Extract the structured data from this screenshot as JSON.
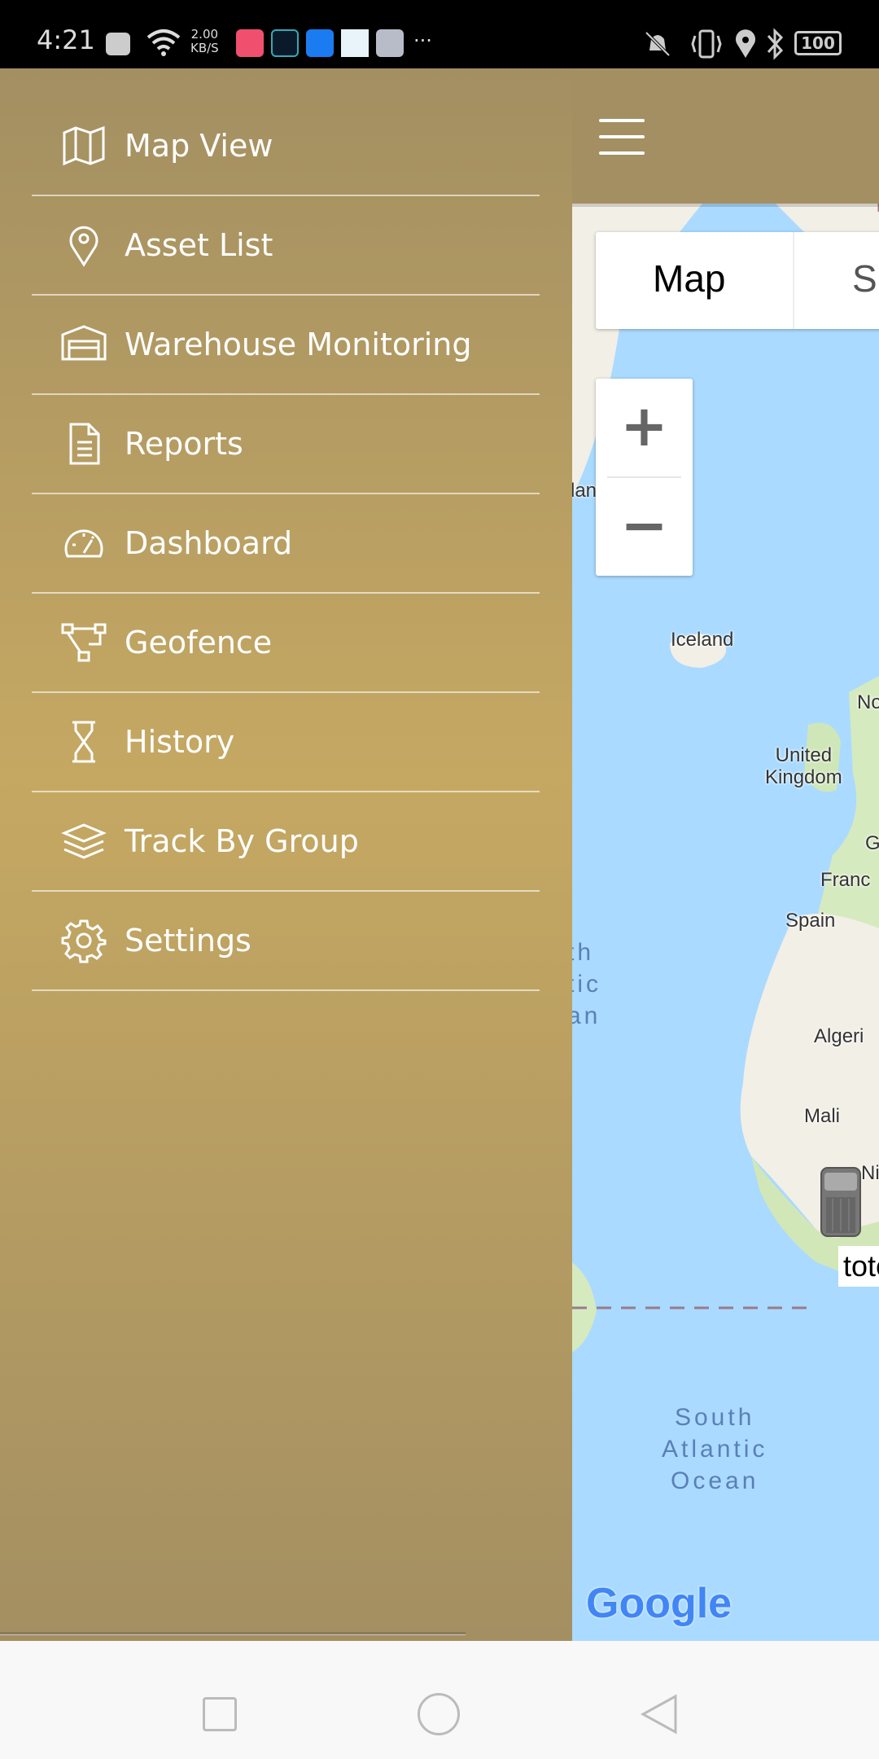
{
  "status_bar": {
    "time": "4:21",
    "net_speed_value": "2.00",
    "net_speed_unit": "KB/S",
    "battery": "100",
    "icons": [
      "close-notification-icon",
      "wifi-icon",
      "app-icon-red",
      "location-app-icon",
      "usb-icon",
      "tracker-app-icon",
      "share-app-icon",
      "more-dots-icon",
      "mute-vibrate-icon",
      "vibrate-icon",
      "location-icon",
      "bluetooth-icon",
      "battery-icon"
    ]
  },
  "drawer": {
    "items": [
      {
        "label": "Map View",
        "icon": "map-icon"
      },
      {
        "label": "Asset List",
        "icon": "pin-icon"
      },
      {
        "label": "Warehouse Monitoring",
        "icon": "warehouse-icon"
      },
      {
        "label": "Reports",
        "icon": "document-icon"
      },
      {
        "label": "Dashboard",
        "icon": "speedometer-icon"
      },
      {
        "label": "Geofence",
        "icon": "geofence-icon"
      },
      {
        "label": "History",
        "icon": "hourglass-icon"
      },
      {
        "label": "Track By Group",
        "icon": "layers-icon"
      },
      {
        "label": "Settings",
        "icon": "gear-icon"
      }
    ]
  },
  "map": {
    "type_control": {
      "map": "Map",
      "satellite_partial": "S"
    },
    "zoom_in": "+",
    "zoom_out": "−",
    "labels": {
      "iceland": "Iceland",
      "uk1": "United",
      "uk2": "Kingdom",
      "france": "Franc",
      "spain": "Spain",
      "algeria": "Algeri",
      "mali": "Mali",
      "no": "No",
      "g": "G",
      "ni": "Ni",
      "lan": "lan",
      "nao1": "th",
      "nao2": "tic",
      "nao3": "an",
      "sao1": "South",
      "sao2": "Atlantic",
      "sao3": "Ocean"
    },
    "asset_label": "tote",
    "google": "Google"
  },
  "colors": {
    "drawer": "#c5a862",
    "water": "#aadaff",
    "land": "#f2efe6"
  }
}
